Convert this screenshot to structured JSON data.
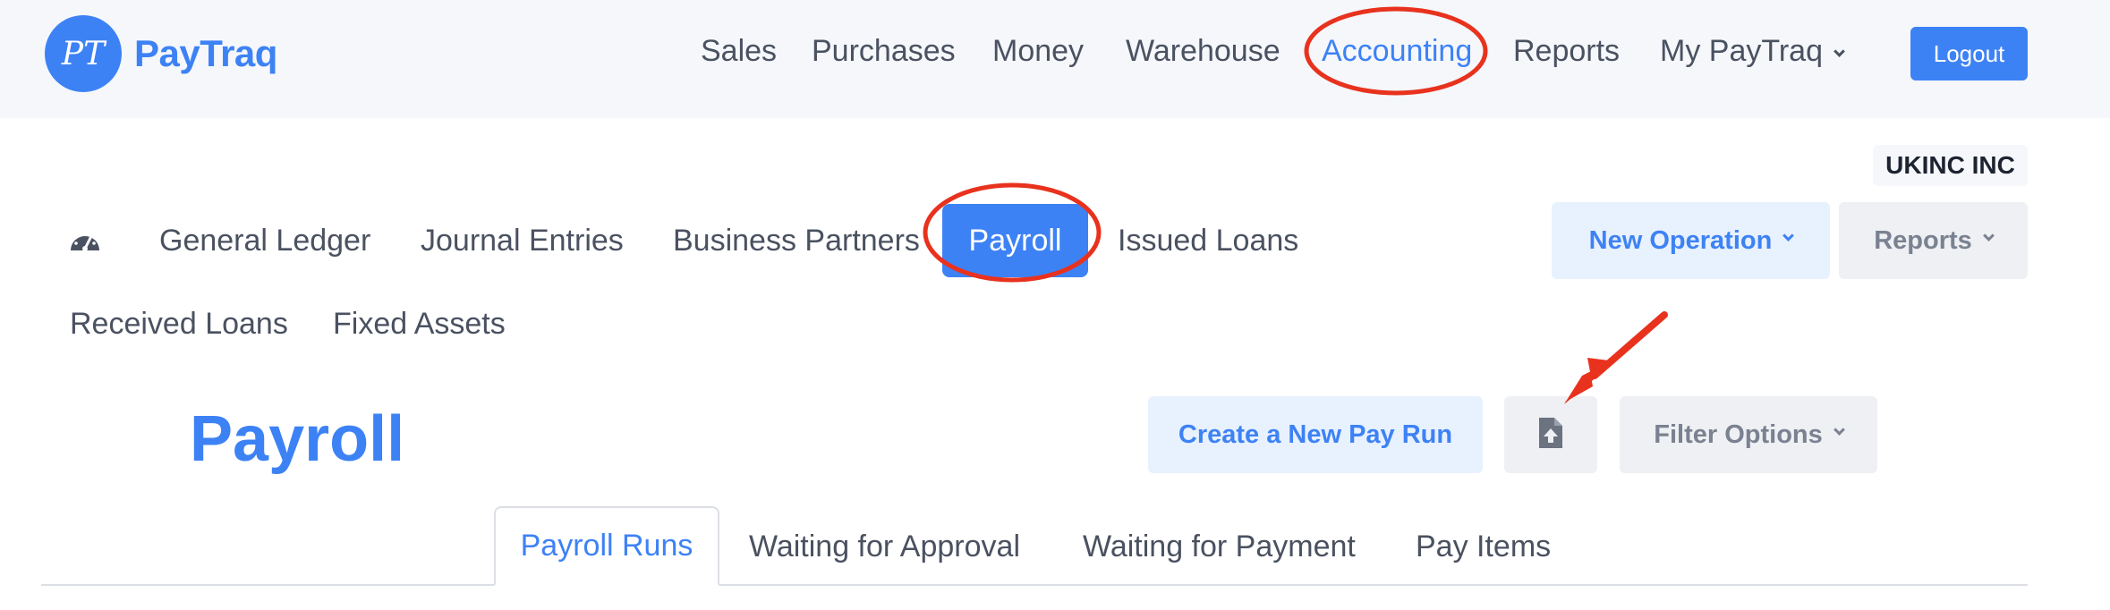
{
  "app": {
    "logo_initials": "PT",
    "logo_name": "PayTraq"
  },
  "top_nav": {
    "items": [
      "Sales",
      "Purchases",
      "Money",
      "Warehouse",
      "Accounting",
      "Reports",
      "My PayTraq"
    ],
    "active": "Accounting",
    "logout_label": "Logout"
  },
  "company_name": "UKINC INC",
  "sub_nav": {
    "items": [
      "General Ledger",
      "Journal Entries",
      "Business Partners",
      "Payroll",
      "Issued Loans",
      "Received Loans",
      "Fixed Assets"
    ],
    "active": "Payroll",
    "new_operation_label": "New Operation",
    "reports_label": "Reports"
  },
  "page": {
    "title": "Payroll",
    "create_label": "Create a New Pay Run",
    "import_icon": "file-upload-icon",
    "filter_label": "Filter Options"
  },
  "tabs": {
    "items": [
      "Payroll Runs",
      "Waiting for Approval",
      "Waiting for Payment",
      "Pay Items"
    ],
    "active": "Payroll Runs"
  },
  "colors": {
    "accent": "#3d82f5",
    "annotation": "#e8321e",
    "topbar_bg": "#f5f7fb"
  }
}
